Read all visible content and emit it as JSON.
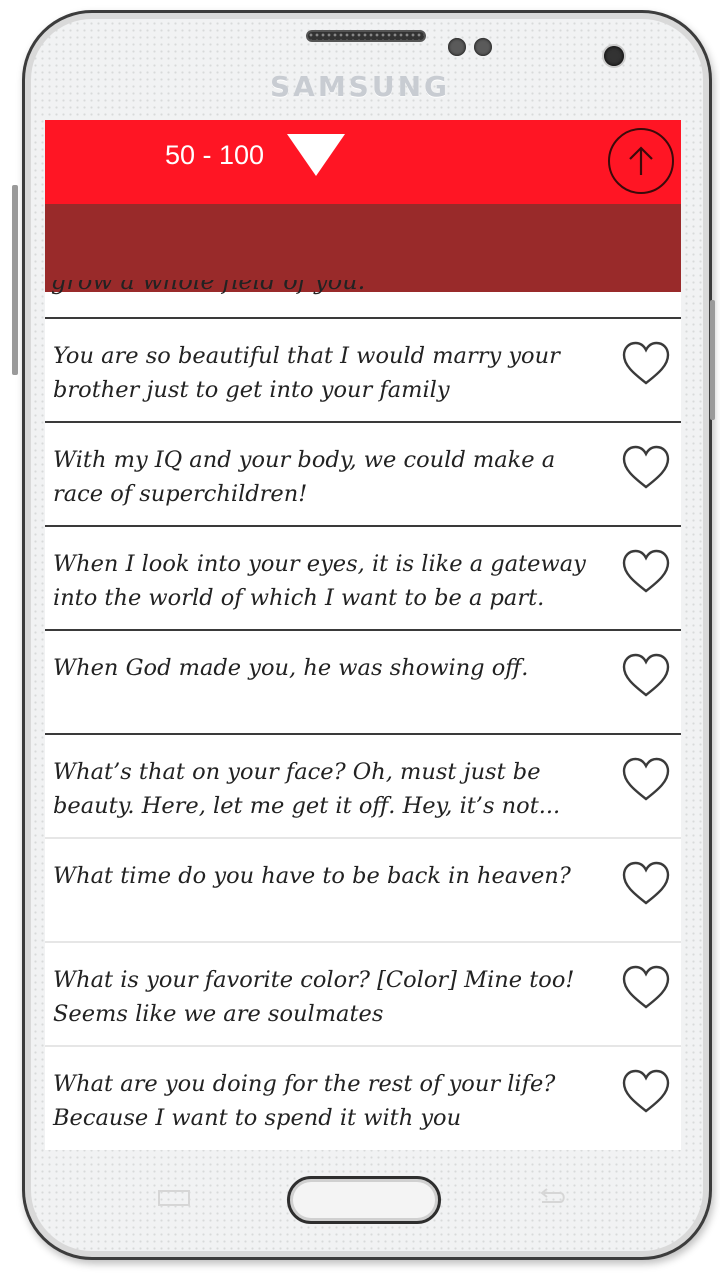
{
  "device": {
    "brand": "SAMSUNG"
  },
  "toolbar": {
    "range_label": "50 - 100",
    "colors": {
      "primary": "#ff1524",
      "secondary": "#992a2a"
    }
  },
  "partial_item": "grow a whole field of you.",
  "items": [
    {
      "text": "You are so beautiful that I would marry your brother just to get into your family",
      "favorite": false
    },
    {
      "text": "With my IQ and your body, we could make a race of superchildren!",
      "favorite": false
    },
    {
      "text": "When I look into your eyes, it is like a gateway into the world of which I want to be a part.",
      "favorite": false
    },
    {
      "text": "When God made you, he was showing off.",
      "favorite": false
    },
    {
      "text": "What’s that on your face? Oh, must just be beauty. Here, let me get it off. Hey, it’s not...",
      "favorite": false
    },
    {
      "text": "What time do you have to be back in heaven?",
      "favorite": false
    },
    {
      "text": "What is your favorite color? [Color] Mine too! Seems like we are soulmates",
      "favorite": false
    },
    {
      "text": "What are you doing for the rest of your life? Because I want to spend it with you",
      "favorite": false
    }
  ]
}
